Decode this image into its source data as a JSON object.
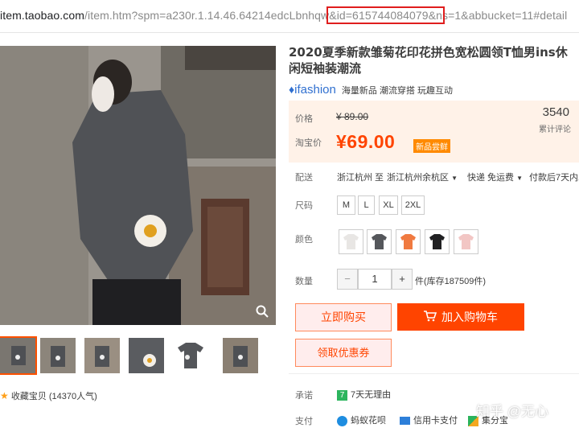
{
  "url": {
    "host": "item.taobao.com",
    "path_before": "/item.htm?spm=a230r.1.14.46.64214edcLbnhqw",
    "highlighted": "&id=615744084079&n",
    "path_after": "s=1&abbucket=11#detail"
  },
  "product": {
    "title": "2020夏季新款雏菊花印花拼色宽松圆领T恤男ins休闲短袖装潮流",
    "brand": "ifashion",
    "brand_tags": "海量新品 潮流穿搭 玩趣互动"
  },
  "price": {
    "label": "价格",
    "original": "¥ 89.00",
    "promo_label": "淘宝价",
    "current": "¥69.00",
    "badge": "新品尝鲜",
    "review_count": "3540",
    "review_label": "累计评论"
  },
  "shipping": {
    "label": "配送",
    "from": "浙江杭州 至",
    "to": "浙江杭州余杭区",
    "method": "快递 免运费",
    "payment": "付款后7天内发"
  },
  "size": {
    "label": "尺码",
    "options": [
      "M",
      "L",
      "XL",
      "2XL"
    ]
  },
  "color": {
    "label": "颜色"
  },
  "quantity": {
    "label": "数量",
    "minus": "−",
    "value": "1",
    "plus": "+",
    "stock": "件(库存187509件)"
  },
  "buttons": {
    "buy_now": "立即购买",
    "add_cart": "加入购物车",
    "coupon": "领取优惠券"
  },
  "promise": {
    "label": "承诺",
    "value": "7天无理由"
  },
  "pay": {
    "label": "支付",
    "methods": [
      "蚂蚁花呗",
      "信用卡支付",
      "集分宝"
    ]
  },
  "favorite": {
    "label": "收藏宝贝",
    "count": "(14370人气)"
  },
  "watermark": "知乎 @无心",
  "colors": {
    "accent": "#ff4400",
    "price_bg": "#fff2e8",
    "highlight_box": "#e01e1e"
  }
}
